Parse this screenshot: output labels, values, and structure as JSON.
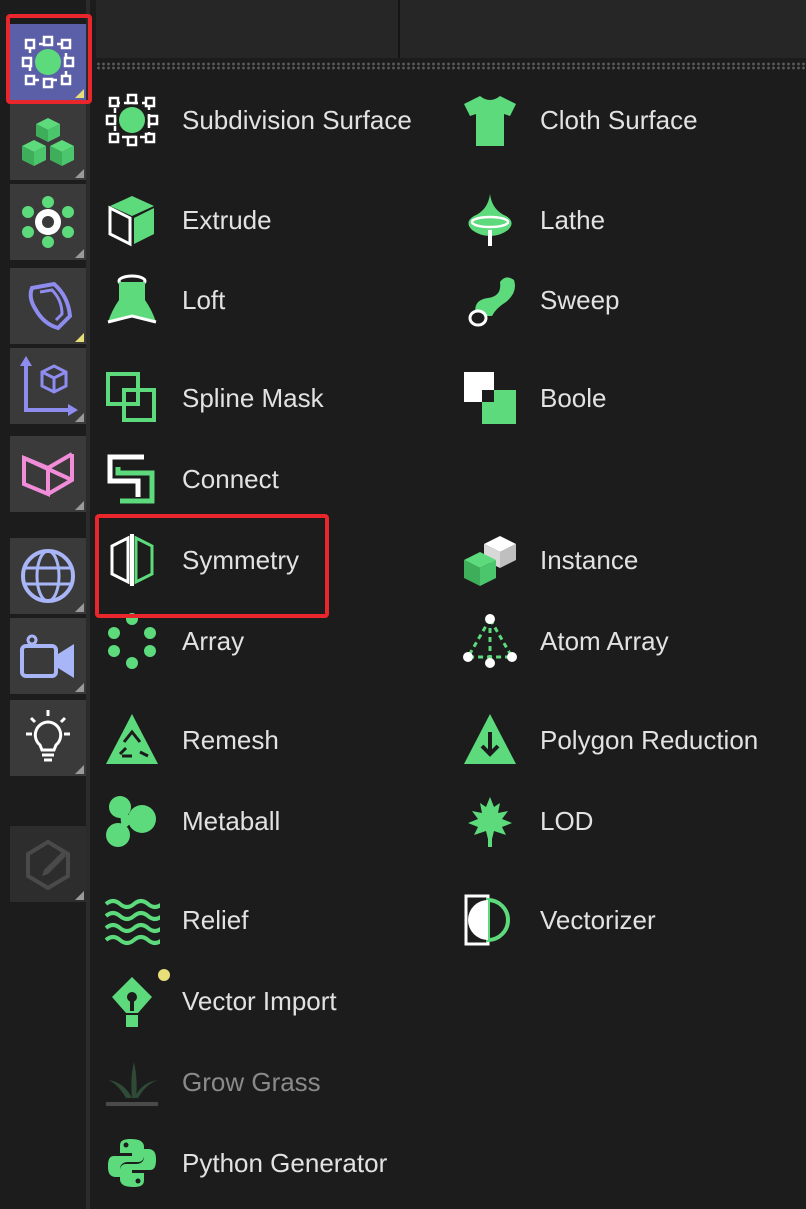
{
  "colors": {
    "accent_green": "#5ddb7c",
    "active_tool_bg": "#5a5fa8",
    "highlight_red": "#e8262b",
    "notice_yellow": "#e8df7a"
  },
  "toolbar": {
    "buttons": [
      {
        "icon": "subdivision-generator-icon",
        "active": true
      },
      {
        "icon": "cubes-icon"
      },
      {
        "icon": "gear-cluster-icon"
      },
      {
        "icon": "deformer-shape-icon"
      },
      {
        "icon": "axis-cube-icon"
      },
      {
        "icon": "pink-fields-icon"
      },
      {
        "icon": "globe-icon"
      },
      {
        "icon": "camera-icon"
      },
      {
        "icon": "light-bulb-icon"
      },
      {
        "icon": "edit-disabled-icon"
      }
    ]
  },
  "menu": {
    "items": [
      {
        "label": "Subdivision Surface",
        "icon": "subdivision-surface-icon"
      },
      {
        "label": "Cloth Surface",
        "icon": "cloth-surface-icon"
      },
      {
        "label": "Extrude",
        "icon": "extrude-icon"
      },
      {
        "label": "Lathe",
        "icon": "lathe-icon"
      },
      {
        "label": "Loft",
        "icon": "loft-icon"
      },
      {
        "label": "Sweep",
        "icon": "sweep-icon"
      },
      {
        "label": "Spline Mask",
        "icon": "spline-mask-icon"
      },
      {
        "label": "Boole",
        "icon": "boole-icon"
      },
      {
        "label": "Connect",
        "icon": "connect-icon"
      },
      {
        "label": "Symmetry",
        "icon": "symmetry-icon",
        "highlighted": true
      },
      {
        "label": "Instance",
        "icon": "instance-icon"
      },
      {
        "label": "Array",
        "icon": "array-icon"
      },
      {
        "label": "Atom Array",
        "icon": "atom-array-icon"
      },
      {
        "label": "Remesh",
        "icon": "remesh-icon"
      },
      {
        "label": "Polygon Reduction",
        "icon": "polygon-reduction-icon"
      },
      {
        "label": "Metaball",
        "icon": "metaball-icon"
      },
      {
        "label": "LOD",
        "icon": "lod-icon"
      },
      {
        "label": "Relief",
        "icon": "relief-icon"
      },
      {
        "label": "Vectorizer",
        "icon": "vectorizer-icon"
      },
      {
        "label": "Vector Import",
        "icon": "vector-import-icon",
        "new_badge": true
      },
      {
        "label": "Grow Grass",
        "icon": "grow-grass-icon",
        "disabled": true
      },
      {
        "label": "Python Generator",
        "icon": "python-generator-icon"
      }
    ]
  }
}
